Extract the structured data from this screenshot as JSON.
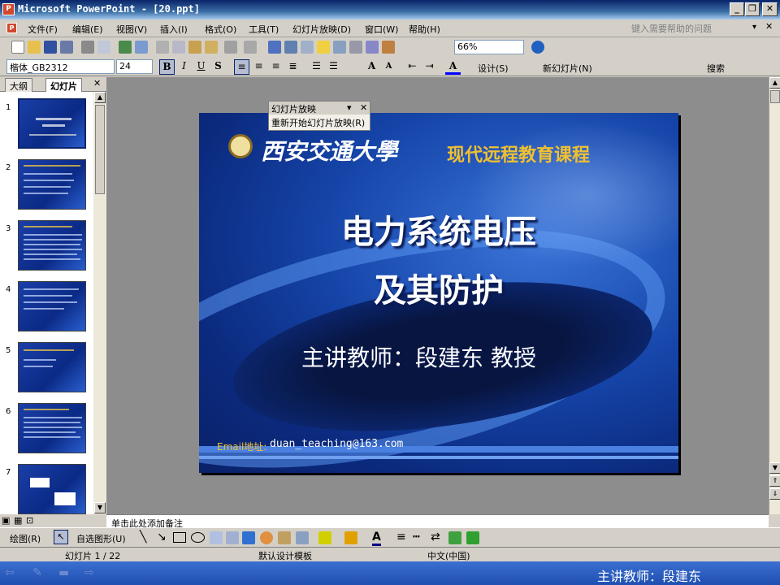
{
  "window": {
    "title": "Microsoft PowerPoint - [20.ppt]",
    "app_icon": "P"
  },
  "menu": {
    "items": [
      "文件(F)",
      "编辑(E)",
      "视图(V)",
      "插入(I)",
      "格式(O)",
      "工具(T)",
      "幻灯片放映(D)",
      "窗口(W)",
      "帮助(H)"
    ],
    "help_placeholder": "键入需要帮助的问题"
  },
  "standard_toolbar": {
    "zoom": "66%"
  },
  "format_toolbar": {
    "font": "楷体_GB2312",
    "size": "24",
    "design_label": "设计(S)",
    "new_slide_label": "新幻灯片(N)",
    "search_label": "搜索"
  },
  "panel": {
    "tabs": [
      "大纲",
      "幻灯片"
    ],
    "active_tab": "幻灯片",
    "slide_numbers": [
      "1",
      "2",
      "3",
      "4",
      "5",
      "6",
      "7"
    ]
  },
  "popup": {
    "title": "幻灯片放映",
    "item": "重新开始幻灯片放映(R)"
  },
  "slide": {
    "university": "西安交通大學",
    "course": "现代远程教育课程",
    "title_line1": "电力系统电压",
    "title_line2": "及其防护",
    "lecturer": "主讲教师：段建东  教授",
    "email_label": "Email地址:",
    "email": "duan_teaching@163.com"
  },
  "notes": {
    "placeholder": "单击此处添加备注"
  },
  "draw_toolbar": {
    "draw_label": "绘图(R)",
    "autoshape_label": "自选图形(U)"
  },
  "status": {
    "slide_pos": "幻灯片 1 / 22",
    "template": "默认设计模板",
    "language": "中文(中国)"
  },
  "taskbar": {
    "text": "主讲教师：段建东"
  },
  "colors": {
    "slide_bg": "#1544a8",
    "course_text": "#f0c030",
    "email_label": "#f0c030"
  }
}
